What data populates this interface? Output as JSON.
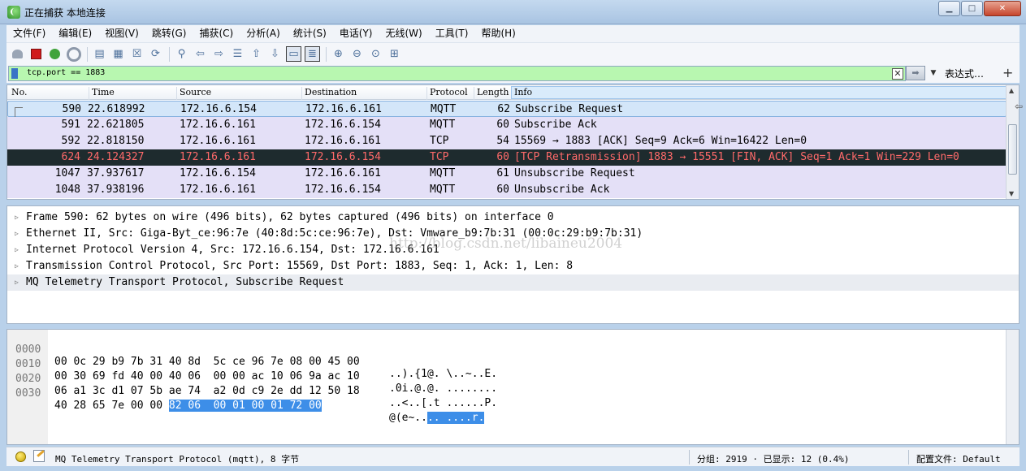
{
  "window": {
    "title": "正在捕获 本地连接",
    "minimize": "▁",
    "maximize": "□",
    "close": "✕"
  },
  "menu": [
    "文件(F)",
    "编辑(E)",
    "视图(V)",
    "跳转(G)",
    "捕获(C)",
    "分析(A)",
    "统计(S)",
    "电话(Y)",
    "无线(W)",
    "工具(T)",
    "帮助(H)"
  ],
  "toolbar": {
    "icons": [
      "shark-fin-icon",
      "stop-capture-icon",
      "restart-capture-icon",
      "capture-options-icon",
      "open-file-icon",
      "save-file-icon",
      "close-file-icon",
      "reload-file-icon",
      "find-packet-icon",
      "go-back-icon",
      "go-forward-icon",
      "go-to-packet-icon",
      "go-first-icon",
      "go-last-icon",
      "auto-scroll-icon",
      "colorize-icon",
      "zoom-in-icon",
      "zoom-out-icon",
      "normal-size-icon",
      "resize-columns-icon"
    ]
  },
  "filter": {
    "value": "tcp.port == 1883",
    "expression_label": "表达式…",
    "plus": "+"
  },
  "packet_list": {
    "columns": [
      "No.",
      "Time",
      "Source",
      "Destination",
      "Protocol",
      "Length",
      "Info"
    ],
    "rows": [
      {
        "no": "590",
        "time": "22.618992",
        "src": "172.16.6.154",
        "dst": "172.16.6.161",
        "proto": "MQTT",
        "len": "62",
        "info": "Subscribe Request"
      },
      {
        "no": "591",
        "time": "22.621805",
        "src": "172.16.6.161",
        "dst": "172.16.6.154",
        "proto": "MQTT",
        "len": "60",
        "info": "Subscribe Ack"
      },
      {
        "no": "592",
        "time": "22.818150",
        "src": "172.16.6.161",
        "dst": "172.16.6.161",
        "proto": "TCP",
        "len": "54",
        "info": "15569 → 1883 [ACK] Seq=9 Ack=6 Win=16422 Len=0"
      },
      {
        "no": "624",
        "time": "24.124327",
        "src": "172.16.6.161",
        "dst": "172.16.6.154",
        "proto": "TCP",
        "len": "60",
        "info": "[TCP Retransmission] 1883 → 15551 [FIN, ACK] Seq=1 Ack=1 Win=229 Len=0"
      },
      {
        "no": "1047",
        "time": "37.937617",
        "src": "172.16.6.154",
        "dst": "172.16.6.161",
        "proto": "MQTT",
        "len": "61",
        "info": "Unsubscribe Request"
      },
      {
        "no": "1048",
        "time": "37.938196",
        "src": "172.16.6.161",
        "dst": "172.16.6.154",
        "proto": "MQTT",
        "len": "60",
        "info": "Unsubscribe Ack"
      }
    ]
  },
  "details": {
    "rows": [
      "Frame 590: 62 bytes on wire (496 bits), 62 bytes captured (496 bits) on interface 0",
      "Ethernet II, Src: Giga-Byt_ce:96:7e (40:8d:5c:ce:96:7e), Dst: Vmware_b9:7b:31 (00:0c:29:b9:7b:31)",
      "Internet Protocol Version 4, Src: 172.16.6.154, Dst: 172.16.6.161",
      "Transmission Control Protocol, Src Port: 15569, Dst Port: 1883, Seq: 1, Ack: 1, Len: 8",
      "MQ Telemetry Transport Protocol, Subscribe Request"
    ],
    "watermark": "http://blog.csdn.net/libaineu2004"
  },
  "bytes": {
    "rows": [
      {
        "off": "0000",
        "hex": "00 0c 29 b9 7b 31 40 8d  5c ce 96 7e 08 00 45 00",
        "ascii": "..).{1@. \\..~..E."
      },
      {
        "off": "0010",
        "hex": "00 30 69 fd 40 00 40 06  00 00 ac 10 06 9a ac 10",
        "ascii": ".0i.@.@. ........"
      },
      {
        "off": "0020",
        "hex": "06 a1 3c d1 07 5b ae 74  a2 0d c9 2e dd 12 50 18",
        "ascii": "..<..[.t ......P."
      },
      {
        "off": "0030",
        "hex_plain": "40 28 65 7e 00 00 ",
        "hex_hl": "82 06  00 01 00 01 72 00",
        "ascii_plain": "@(e~..",
        "ascii_hl": ".. ....r."
      }
    ]
  },
  "status": {
    "selected_field": "MQ Telemetry Transport Protocol (mqtt), 8 字节",
    "packets": "分组: 2919 · 已显示: 12 (0.4%)",
    "profile": "配置文件: Default"
  }
}
